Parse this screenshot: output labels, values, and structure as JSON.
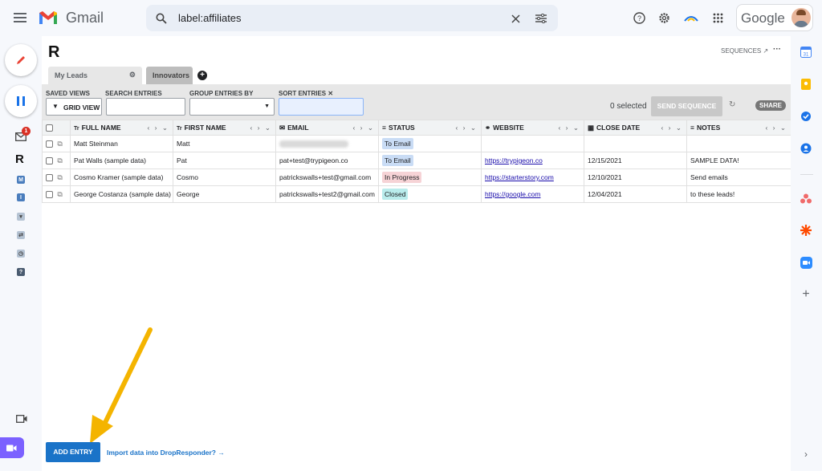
{
  "header": {
    "app_name": "Gmail",
    "search_query": "label:affiliates",
    "google_label": "Google"
  },
  "plugin": {
    "sequences_label": "SEQUENCES",
    "more_label": "···",
    "tabs": [
      {
        "label": "My Leads"
      },
      {
        "label": "Innovators"
      }
    ]
  },
  "toolbar": {
    "saved_views_label": "SAVED VIEWS",
    "grid_view_label": "GRID VIEW",
    "search_label": "SEARCH ENTRIES",
    "group_label": "GROUP ENTRIES BY",
    "sort_label": "SORT ENTRIES ✕",
    "selected_count": "0 selected",
    "send_sequence_label": "SEND SEQUENCE",
    "share_label": "SHARE"
  },
  "table": {
    "columns": [
      {
        "label": "FULL NAME",
        "icon": "Tr"
      },
      {
        "label": "FIRST NAME",
        "icon": "Tr"
      },
      {
        "label": "EMAIL",
        "icon": "✉"
      },
      {
        "label": "STATUS",
        "icon": "≡"
      },
      {
        "label": "WEBSITE",
        "icon": "⚭"
      },
      {
        "label": "CLOSE DATE",
        "icon": "▦"
      },
      {
        "label": "NOTES",
        "icon": "≡"
      }
    ],
    "nav_label": "‹ › ⌄",
    "rows": [
      {
        "full_name": "Matt Steinman",
        "first_name": "Matt",
        "email": "",
        "status": "To Email",
        "website": "",
        "close_date": "",
        "notes": ""
      },
      {
        "full_name": "Pat Walls (sample data)",
        "first_name": "Pat",
        "email": "pat+test@trypigeon.co",
        "status": "To Email",
        "website": "https://trypigeon.co",
        "close_date": "12/15/2021",
        "notes": "SAMPLE DATA!"
      },
      {
        "full_name": "Cosmo Kramer (sample data)",
        "first_name": "Cosmo",
        "email": "patrickswalls+test@gmail.com",
        "status": "In Progress",
        "website": "https://starterstory.com",
        "close_date": "12/10/2021",
        "notes": "Send emails"
      },
      {
        "full_name": "George Costanza (sample data)",
        "first_name": "George",
        "email": "patrickswalls+test2@gmail.com",
        "status": "Closed",
        "website": "https://google.com",
        "close_date": "12/04/2021",
        "notes": "to these leads!"
      }
    ]
  },
  "footer": {
    "add_entry_label": "ADD ENTRY",
    "import_label": "Import data into DropResponder? →"
  },
  "leftrail": {
    "mail_badge": "1",
    "items": [
      "M",
      "I"
    ]
  },
  "colors": {
    "accent_blue": "#1a73e8",
    "status_to_email": "#c9dcf5",
    "status_in_progress": "#f6d3d6",
    "status_closed": "#b9ecec",
    "arrow": "#f4b400"
  },
  "icons": [
    "menu-icon",
    "gmail-logo-icon",
    "search-icon",
    "close-icon",
    "filter-icon",
    "help-icon",
    "settings-icon",
    "apps-icon",
    "avatar",
    "compose-icon",
    "pause-icon",
    "mail-icon",
    "calendar-icon",
    "keep-icon",
    "tasks-icon",
    "contacts-icon",
    "asana-icon",
    "zapier-icon",
    "zoom-icon",
    "plus-icon",
    "video-icon",
    "chevron-right-icon"
  ]
}
